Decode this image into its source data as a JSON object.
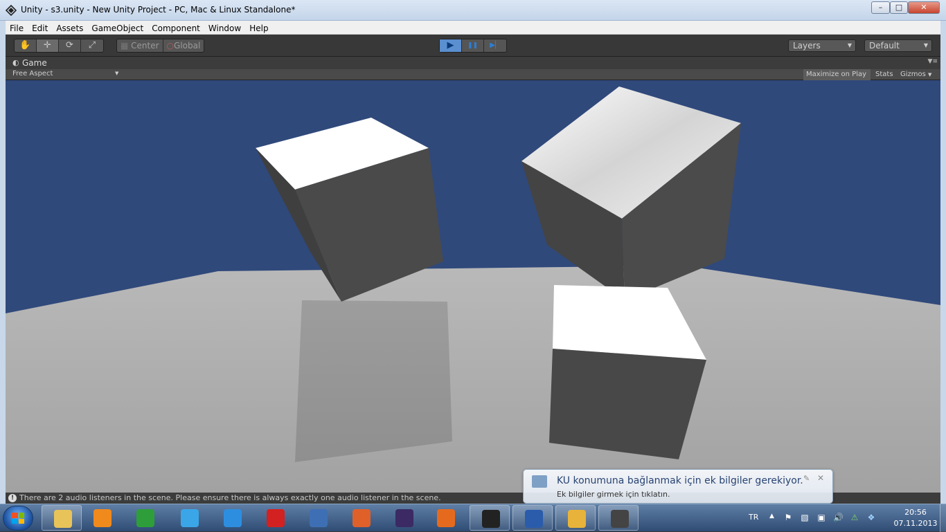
{
  "window": {
    "title": "Unity - s3.unity - New Unity Project - PC, Mac & Linux Standalone*",
    "controls": {
      "minimize": "–",
      "maximize": "□",
      "close": "✕"
    }
  },
  "menu": {
    "items": [
      {
        "label": "File"
      },
      {
        "label": "Edit"
      },
      {
        "label": "Assets"
      },
      {
        "label": "GameObject"
      },
      {
        "label": "Component"
      },
      {
        "label": "Window"
      },
      {
        "label": "Help"
      }
    ]
  },
  "toolbar": {
    "tools": [
      {
        "icon": "hand-icon",
        "glyph": "✋",
        "active": false
      },
      {
        "icon": "move-icon",
        "glyph": "✛",
        "active": true
      },
      {
        "icon": "rotate-icon",
        "glyph": "⟳",
        "active": false
      },
      {
        "icon": "scale-icon",
        "glyph": "⤢",
        "active": false
      }
    ],
    "pivot": {
      "center": "Center",
      "global": "Global"
    },
    "playback": {
      "play": "▶",
      "pause": "❚❚",
      "step": "▶▏"
    },
    "layers": "Layers",
    "layout": "Default"
  },
  "game_panel": {
    "tab_label": "Game",
    "aspect": "Free Aspect",
    "maximize_on_play": "Maximize on Play",
    "stats": "Stats",
    "gizmos": "Gizmos",
    "sky_color": "#30497b",
    "floor_color": "#a9a9a9"
  },
  "status": {
    "message": "There are 2 audio listeners in the scene. Please ensure there is always exactly one audio listener in the scene."
  },
  "notification": {
    "title": "KU konumuna bağlanmak için ek bilgiler gerekiyor.",
    "text": "Ek bilgiler girmek için tıklatın."
  },
  "taskbar": {
    "apps": [
      {
        "name": "windows-explorer-icon",
        "color": "#e8c35a",
        "pinned": true
      },
      {
        "name": "media-player-icon",
        "color": "#f08a1c",
        "pinned": false
      },
      {
        "name": "system-monitor-icon",
        "color": "#2e9e3a",
        "pinned": false
      },
      {
        "name": "itunes-icon",
        "color": "#3aa6e8",
        "pinned": false
      },
      {
        "name": "internet-explorer-icon",
        "color": "#2d8ee0",
        "pinned": false
      },
      {
        "name": "opera-icon",
        "color": "#d32020",
        "pinned": false
      },
      {
        "name": "virtualbox-icon",
        "color": "#3e6fb5",
        "pinned": false
      },
      {
        "name": "matlab-icon",
        "color": "#e0602a",
        "pinned": false
      },
      {
        "name": "eclipse-icon",
        "color": "#3b2a63",
        "pinned": false
      },
      {
        "name": "firefox-icon",
        "color": "#e66a1e",
        "pinned": false
      },
      {
        "name": "unity-icon",
        "color": "#222222",
        "pinned": true
      },
      {
        "name": "word-icon",
        "color": "#2a5cab",
        "pinned": true
      },
      {
        "name": "paint-icon",
        "color": "#e8b33a",
        "pinned": true
      },
      {
        "name": "camera-app-icon",
        "color": "#444444",
        "pinned": true
      }
    ],
    "language": "TR",
    "time": "20:56",
    "date": "07.11.2013"
  }
}
